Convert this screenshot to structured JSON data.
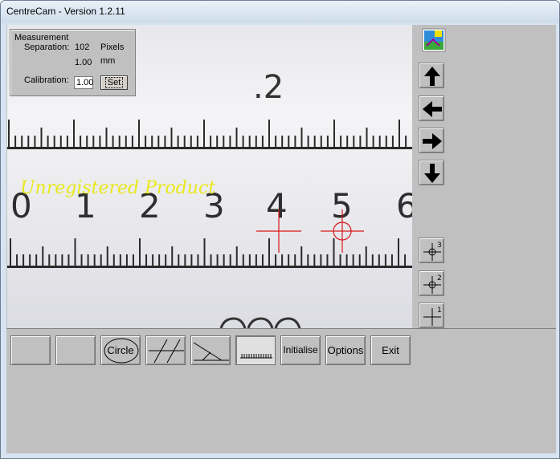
{
  "window": {
    "title": "CentreCam - Version 1.2.11"
  },
  "measurement": {
    "heading": "Measurement",
    "separation_label": "Separation:",
    "separation_pixels": "102",
    "pixels_unit": "Pixels",
    "separation_mm": "1.00",
    "mm_unit": "mm",
    "calibration_label": "Calibration:",
    "calibration_value": "1.00",
    "set_label": "Set"
  },
  "camera": {
    "watermark": "Unregistered  Product",
    "scale_top_label": ".2",
    "scale_numbers": [
      "0",
      "1",
      "2",
      "3",
      "4",
      "5",
      "6"
    ],
    "crosshair_color": "#d81818",
    "watermark_color": "#e8e81a"
  },
  "side_buttons": {
    "logo_icon": "centrecam-logo-icon",
    "up_icon": "arrow-up-icon",
    "left_icon": "arrow-left-icon",
    "right_icon": "arrow-right-icon",
    "down_icon": "arrow-down-icon",
    "crosshair_3": "3",
    "crosshair_2": "2",
    "crosshair_1": "1"
  },
  "toolbar": {
    "circle_label": "Circle",
    "initialise_label": "Initialise",
    "options_label": "Options",
    "exit_label": "Exit"
  }
}
